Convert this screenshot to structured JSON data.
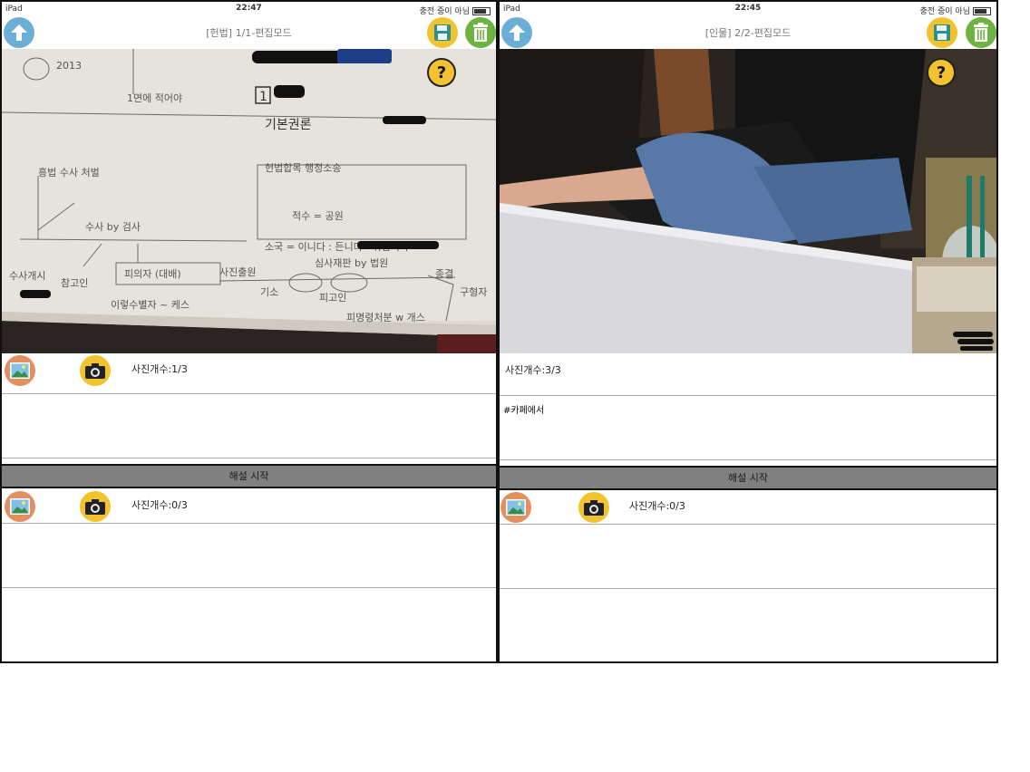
{
  "left": {
    "status": {
      "carrier": "iPad",
      "time": "22:47",
      "right": "충전 중이 아님"
    },
    "nav": {
      "title": "[헌법] 1/1-편집모드"
    },
    "help": "?",
    "question": {
      "count_label": "사진개수:1/3",
      "text": ""
    },
    "explanation": {
      "bar_label": "해설 시작",
      "count_label": "사진개수:0/3",
      "text": ""
    }
  },
  "right": {
    "status": {
      "carrier": "iPad",
      "time": "22:45",
      "right": "충전 중이 아님"
    },
    "nav": {
      "title": "[인물] 2/2-편집모드"
    },
    "help": "?",
    "question": {
      "count_label": "사진개수:3/3",
      "text": "#카페에서"
    },
    "explanation": {
      "bar_label": "해설 시작",
      "count_label": "사진개수:0/3",
      "text": ""
    }
  },
  "colors": {
    "upload": "#6bafd6",
    "save": "#f2c32e",
    "trash": "#6cb33f",
    "gallery": "#e38f5f",
    "camera": "#f2c32e",
    "bar": "#808080"
  },
  "icons": [
    "upload-arrow-icon",
    "save-floppy-icon",
    "trash-icon",
    "help-question-icon",
    "gallery-image-icon",
    "camera-icon"
  ]
}
